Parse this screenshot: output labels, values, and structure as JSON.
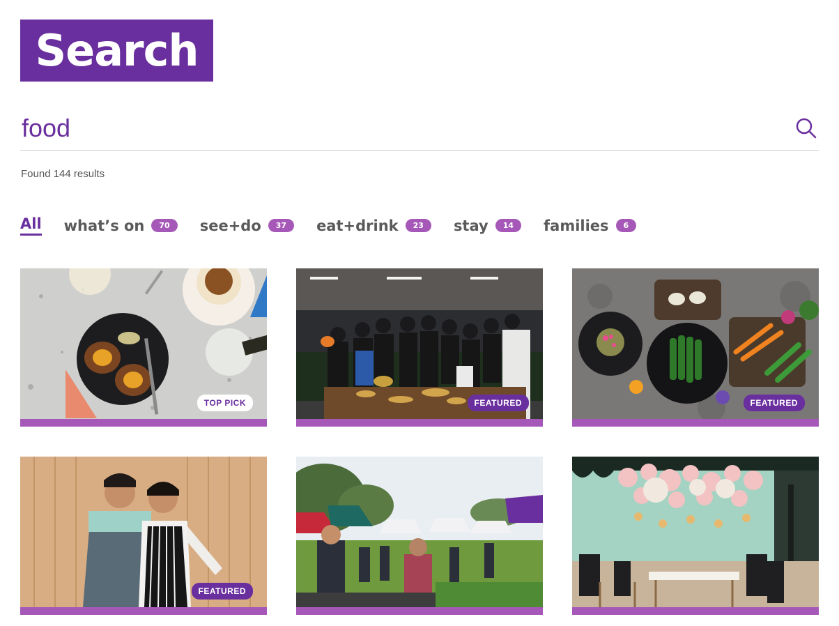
{
  "header": {
    "title": "Search"
  },
  "search": {
    "value": "food",
    "placeholder": ""
  },
  "results": {
    "text": "Found 144 results"
  },
  "tabs": [
    {
      "label": "All",
      "count": null,
      "active": true
    },
    {
      "label": "what’s on",
      "count": "70"
    },
    {
      "label": "see+do",
      "count": "37"
    },
    {
      "label": "eat+drink",
      "count": "23"
    },
    {
      "label": "stay",
      "count": "14"
    },
    {
      "label": "families",
      "count": "6"
    }
  ],
  "cards": [
    {
      "badge": "TOP PICK",
      "image": "scotch-eggs-and-wine"
    },
    {
      "badge": "FEATURED",
      "image": "market-vendors-group"
    },
    {
      "badge": "FEATURED",
      "image": "plated-vegetables"
    },
    {
      "badge": "FEATURED",
      "image": "two-chefs-portrait"
    },
    {
      "badge": "",
      "image": "outdoor-farmers-market"
    },
    {
      "badge": "",
      "image": "restaurant-balloons"
    }
  ],
  "colors": {
    "brand": "#6a2f9e",
    "accent": "#a658b8"
  }
}
